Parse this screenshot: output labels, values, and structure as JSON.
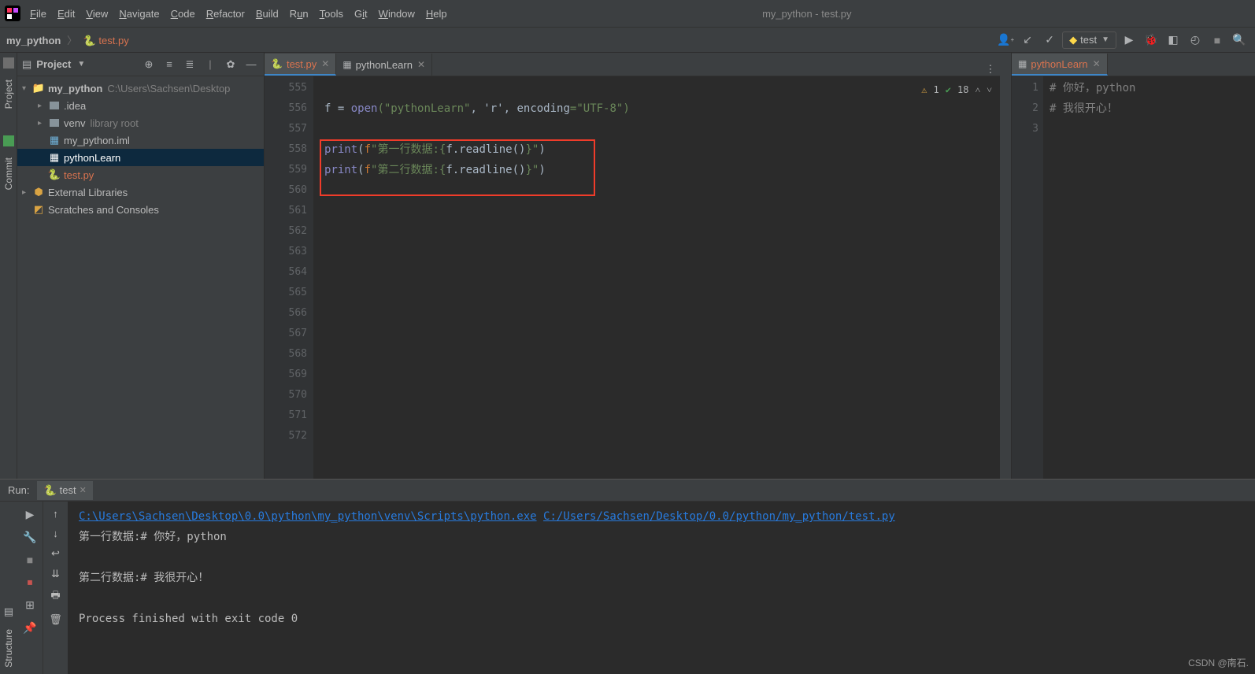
{
  "window_title": "my_python - test.py",
  "menu": [
    "File",
    "Edit",
    "View",
    "Navigate",
    "Code",
    "Refactor",
    "Build",
    "Run",
    "Tools",
    "Git",
    "Window",
    "Help"
  ],
  "breadcrumb": {
    "root": "my_python",
    "file": "test.py"
  },
  "run_config": "test",
  "project_panel": {
    "title": "Project",
    "root": {
      "name": "my_python",
      "path": "C:\\Users\\Sachsen\\Desktop"
    },
    "children": {
      "idea": ".idea",
      "venv": "venv",
      "venv_note": "library root",
      "iml": "my_python.iml",
      "plearn": "pythonLearn",
      "testpy": "test.py"
    },
    "ext_lib": "External Libraries",
    "scratches": "Scratches and Consoles"
  },
  "tabs": {
    "active": "test.py",
    "second": "pythonLearn"
  },
  "gutter_lines": [
    "555",
    "556",
    "557",
    "558",
    "559",
    "560",
    "561",
    "562",
    "563",
    "564",
    "565",
    "566",
    "567",
    "568",
    "569",
    "570",
    "571",
    "572"
  ],
  "code": {
    "l556": {
      "pre": "f = ",
      "fn": "open",
      "args1": "(\"pythonLearn\"",
      "args2": ", 'r', ",
      "kw": "encoding",
      "args3": "=\"UTF-8\")"
    },
    "l558": {
      "fn": "print",
      "open": "(",
      "f": "f",
      "str1": "\"第一行数据:{",
      "inner": "f.readline()",
      "str2": "}\"",
      "close": ")"
    },
    "l559": {
      "fn": "print",
      "open": "(",
      "f": "f",
      "str1": "\"第二行数据:{",
      "inner": "f.readline()",
      "str2": "}\"",
      "close": ")"
    }
  },
  "insp": {
    "warn": "1",
    "check": "18"
  },
  "right_tab": "pythonLearn",
  "right_lines": [
    "1",
    "2",
    "3"
  ],
  "right_code": {
    "l1": "# 你好，python",
    "l2": "# 我很开心！"
  },
  "run": {
    "title": "Run:",
    "tab": "test",
    "link1": "C:\\Users\\Sachsen\\Desktop\\0.0\\python\\my_python\\venv\\Scripts\\python.exe",
    "link2": "C:/Users/Sachsen/Desktop/0.0/python/my_python/test.py",
    "out1": "第一行数据:# 你好，python",
    "out2": "第二行数据:# 我很开心！",
    "exit": "Process finished with exit code 0"
  },
  "vtabs": {
    "project": "Project",
    "commit": "Commit",
    "structure": "Structure"
  },
  "watermark": "CSDN @南石."
}
